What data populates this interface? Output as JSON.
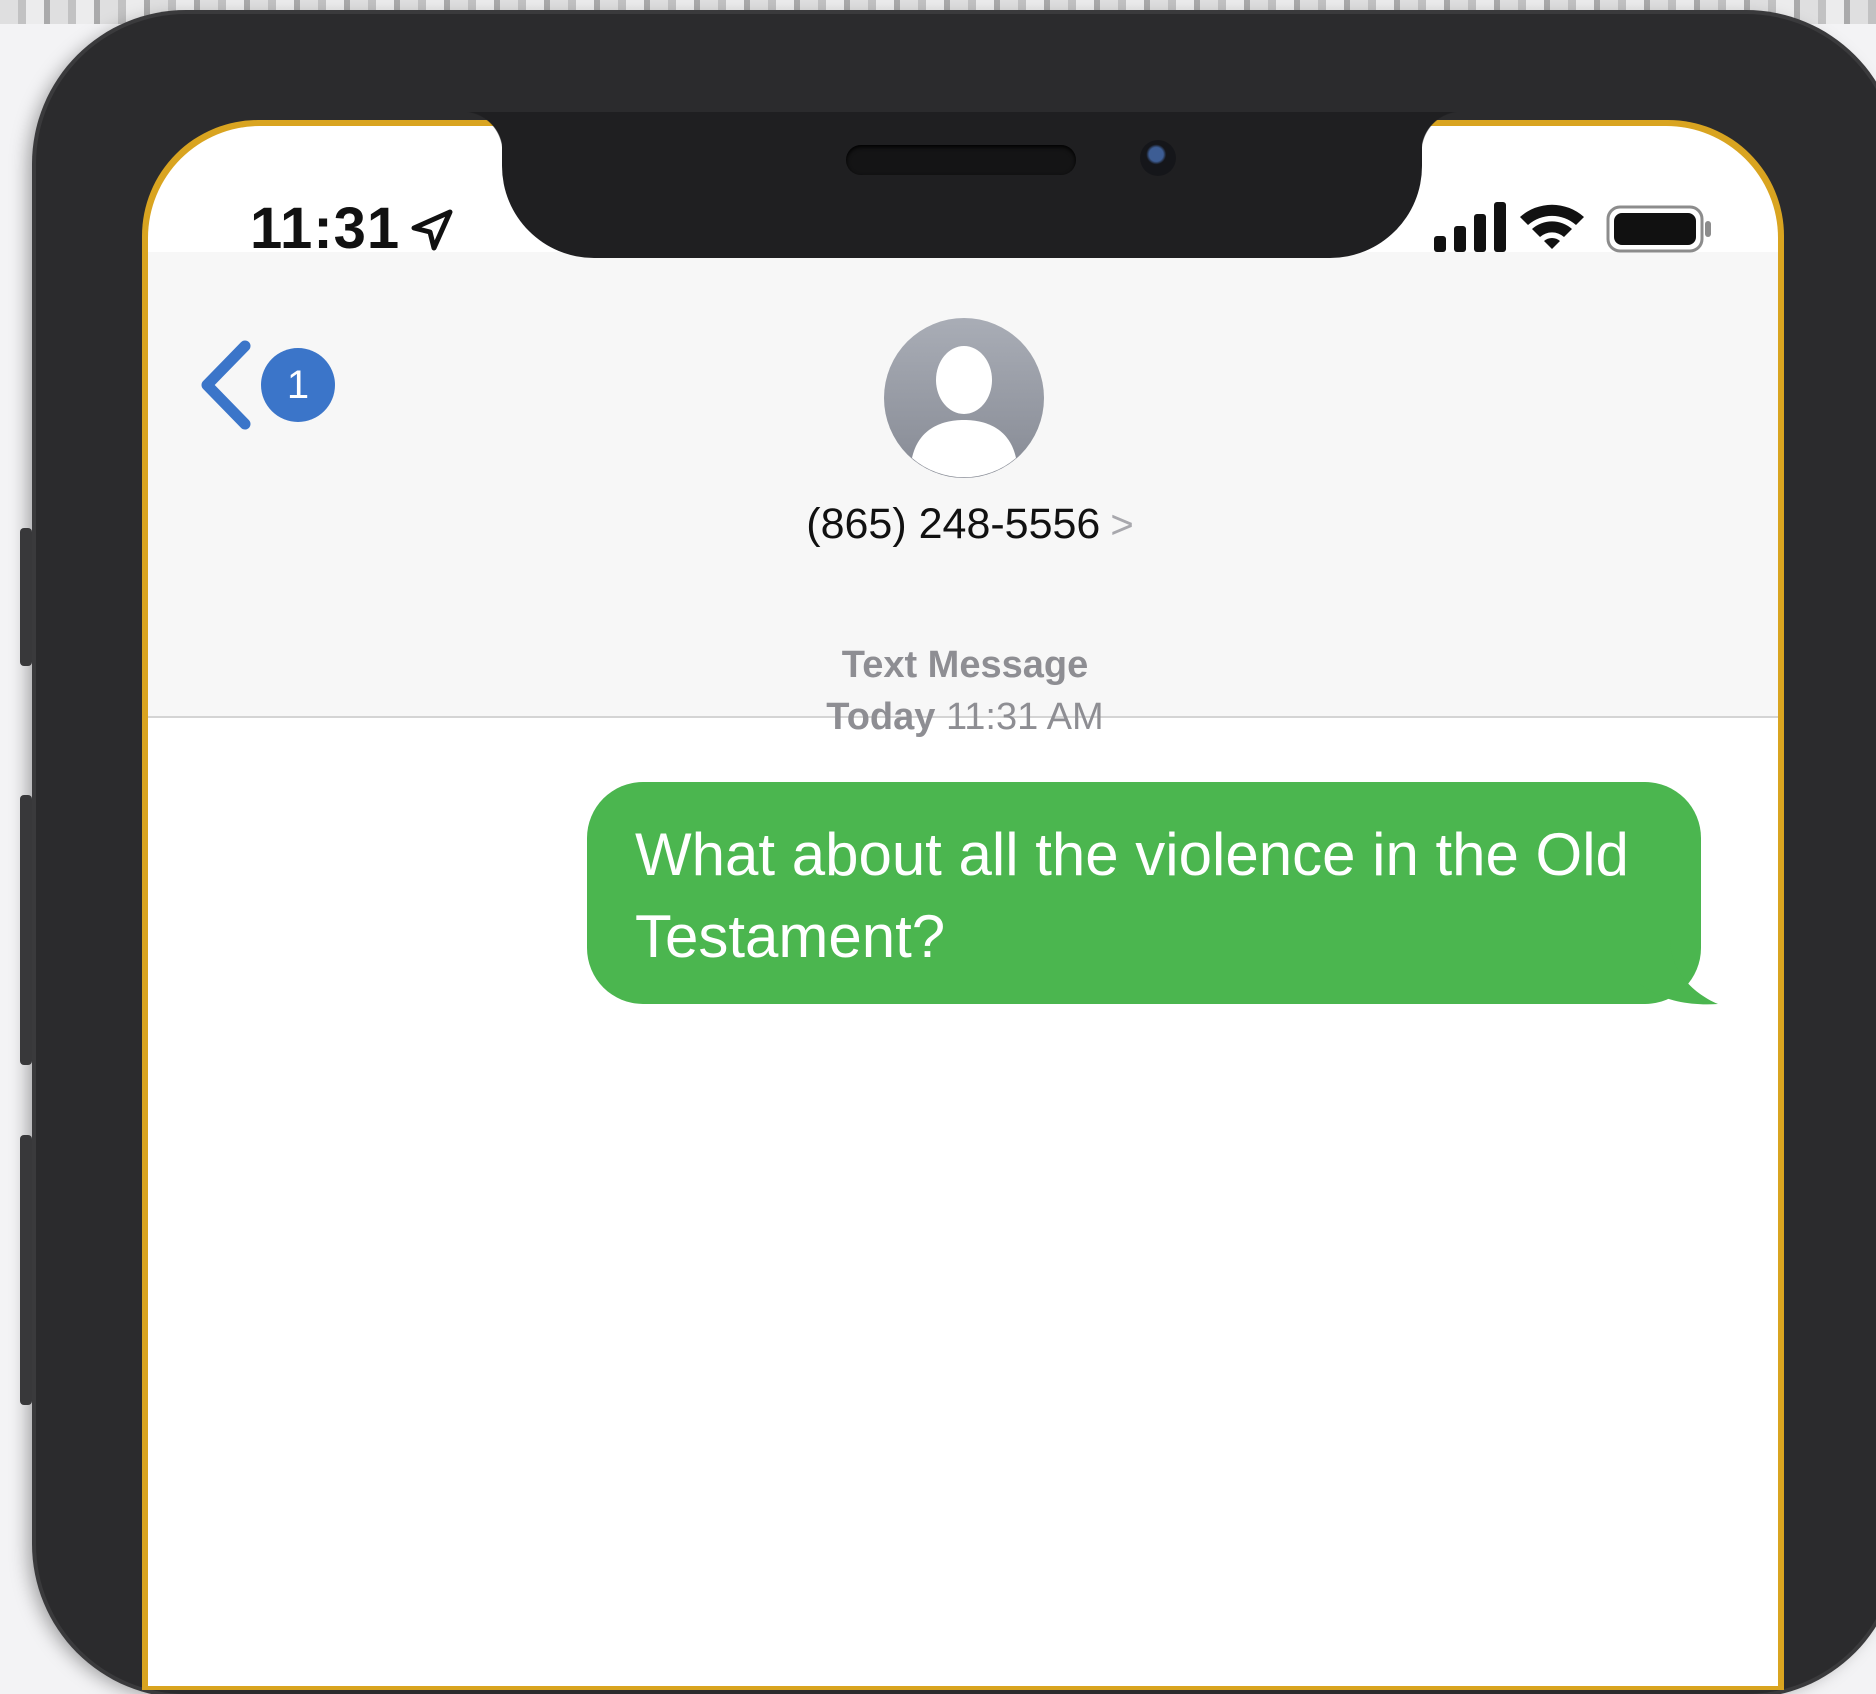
{
  "status_bar": {
    "time": "11:31",
    "icons": [
      "location-arrow-icon",
      "cellular-signal-icon",
      "wifi-icon",
      "battery-icon"
    ]
  },
  "nav": {
    "back_badge": "1",
    "contact_number": "(865) 248-5556",
    "contact_chevron": ">"
  },
  "thread": {
    "message_type": "Text Message",
    "day": "Today",
    "time": "11:31 AM",
    "messages": [
      {
        "direction": "outgoing",
        "text": "What about all the violence in the Old Testament?"
      }
    ]
  },
  "colors": {
    "sms_bubble": "#4bb64f",
    "accent": "#3b75c9",
    "meta_text": "#8e8e93"
  }
}
